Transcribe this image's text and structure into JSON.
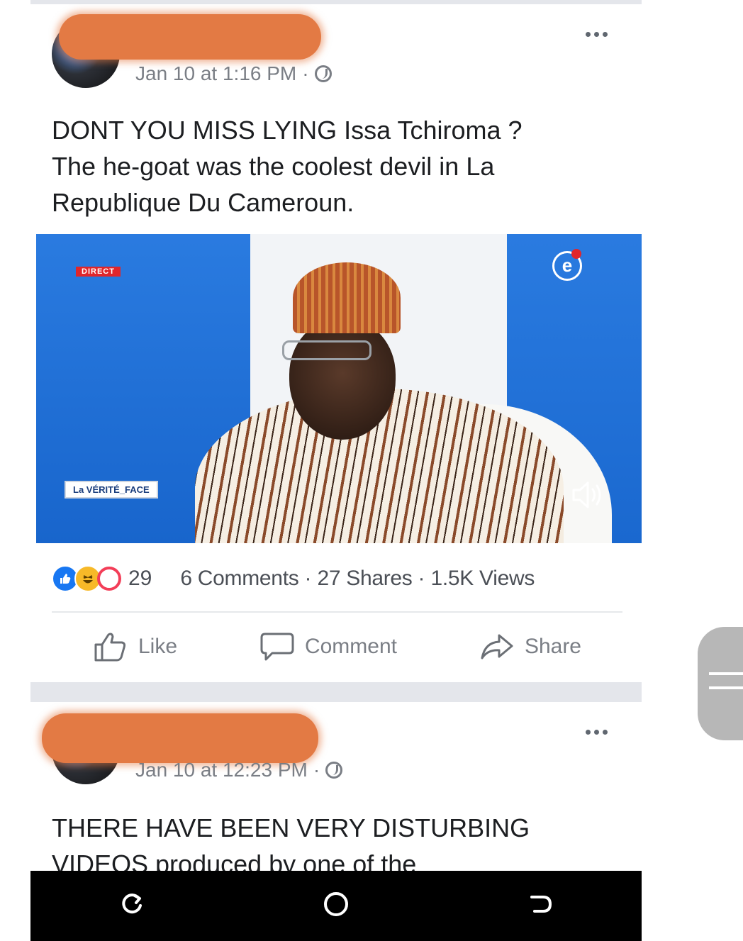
{
  "post1": {
    "timestamp": "Jan 10 at 1:16 PM",
    "separator": "·",
    "text_lines": [
      "DONT YOU MISS LYING Issa Tchiroma ?",
      "The he-goat was the coolest devil in La",
      "Republique Du Cameroun."
    ],
    "video": {
      "live_tag": "DIRECT",
      "show_tag": "La VÉRITÉ_FACE",
      "channel_logo": "e"
    },
    "reactions_count": "29",
    "comments": "6 Comments",
    "shares": "27 Shares",
    "views": "1.5K Views",
    "dot": "·",
    "actions": {
      "like": "Like",
      "comment": "Comment",
      "share": "Share"
    }
  },
  "post2": {
    "timestamp": "Jan 10 at 12:23 PM",
    "separator": "·",
    "text_lines": [
      "THERE HAVE BEEN VERY DISTURBING",
      "VIDEOS produced by one of the"
    ]
  },
  "colors": {
    "redaction": "#e37a44",
    "like_blue": "#1877f2",
    "love_red": "#f33e58",
    "haha_yellow": "#f7b928",
    "navbar": "#000000"
  },
  "icons": [
    "more-options-icon",
    "globe-icon",
    "like-icon",
    "comment-icon",
    "share-icon",
    "sound-icon",
    "recents-icon",
    "home-icon",
    "back-icon"
  ]
}
